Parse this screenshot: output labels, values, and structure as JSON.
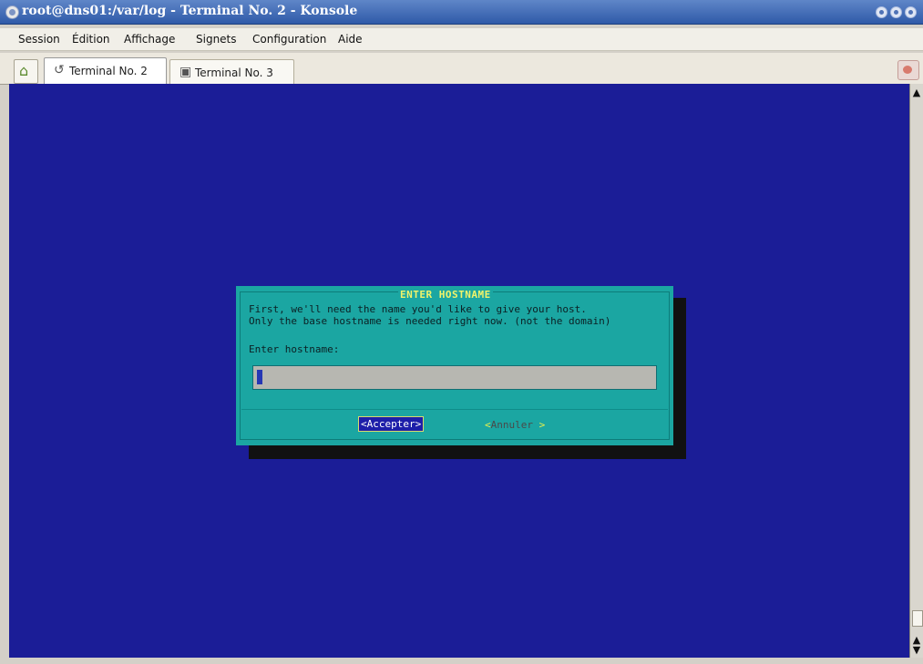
{
  "window": {
    "title": "root@dns01:/var/log - Terminal No. 2 - Konsole"
  },
  "menu": {
    "items": [
      "Session",
      "Édition",
      "Affichage",
      "Signets",
      "Configuration",
      "Aide"
    ]
  },
  "tabs": [
    {
      "label": "Terminal No. 2"
    },
    {
      "label": "Terminal No. 3"
    }
  ],
  "dialog": {
    "title": "ENTER HOSTNAME",
    "line1": "First, we'll need the name you'd like to give your host.",
    "line2": "Only the base hostname is needed right now. (not the domain)",
    "prompt": "Enter hostname:",
    "input_value": "",
    "ok_label": "<Accepter>",
    "cancel_label_main": "Annuler",
    "cancel_open": "<",
    "cancel_close": ">"
  },
  "colors": {
    "terminal_bg": "#1b1d97",
    "dialog_bg": "#1ba6a2",
    "dialog_title": "#f0f36a"
  },
  "icons": {
    "new_session": "new-session-icon",
    "tab_2": "terminal-tab-icon",
    "tab_3": "terminal-tab-icon",
    "right": "clipboard-icon"
  }
}
